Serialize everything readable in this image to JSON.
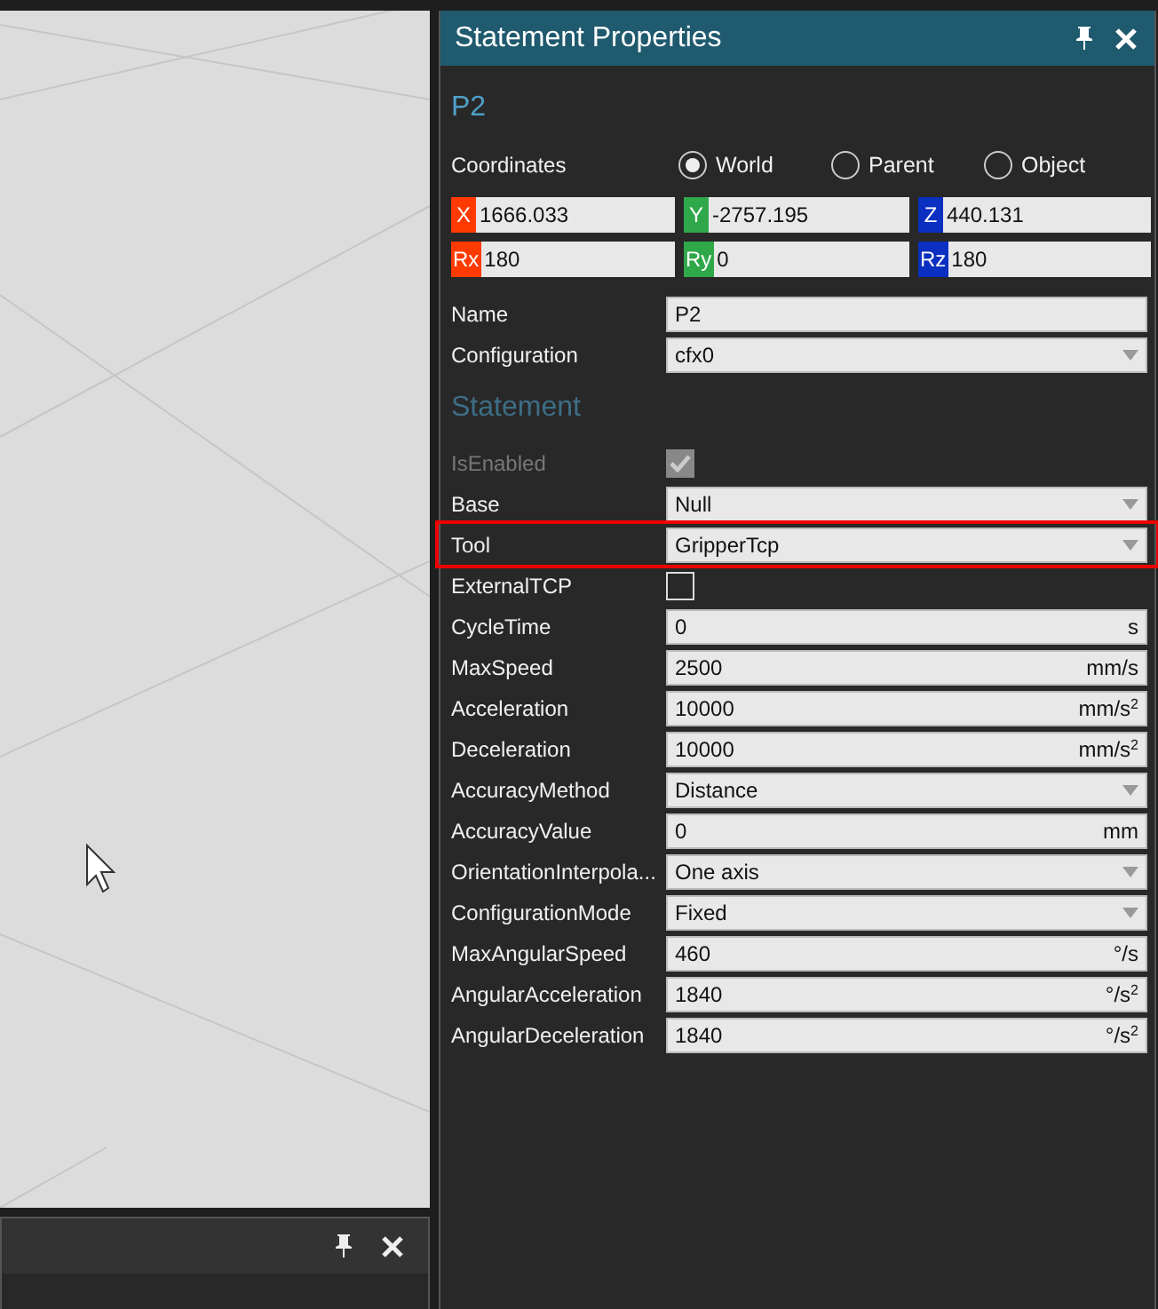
{
  "properties_panel": {
    "title": "Statement Properties",
    "object_name": "P2",
    "coordinates": {
      "label": "Coordinates",
      "options": [
        {
          "label": "World",
          "selected": true
        },
        {
          "label": "Parent",
          "selected": false
        },
        {
          "label": "Object",
          "selected": false
        }
      ]
    },
    "axes": [
      {
        "label": "X",
        "color": "#ff3a00",
        "value": "1666.033"
      },
      {
        "label": "Y",
        "color": "#2fa84a",
        "value": "-2757.195"
      },
      {
        "label": "Z",
        "color": "#0b2fc0",
        "value": "440.131"
      },
      {
        "label": "Rx",
        "color": "#ff3a00",
        "value": "180"
      },
      {
        "label": "Ry",
        "color": "#2fa84a",
        "value": "0"
      },
      {
        "label": "Rz",
        "color": "#0b2fc0",
        "value": "180"
      }
    ],
    "general": [
      {
        "kind": "text",
        "label": "Name",
        "value": "P2"
      },
      {
        "kind": "dropdown",
        "label": "Configuration",
        "value": "cfx0"
      }
    ],
    "section_title": "Statement",
    "statement": [
      {
        "kind": "checkbox",
        "label": "IsEnabled",
        "checked": true,
        "disabled": true
      },
      {
        "kind": "dropdown",
        "label": "Base",
        "value": "Null"
      },
      {
        "kind": "dropdown",
        "label": "Tool",
        "value": "GripperTcp",
        "highlighted": true
      },
      {
        "kind": "checkbox",
        "label": "ExternalTCP",
        "checked": false,
        "disabled": false
      },
      {
        "kind": "text",
        "label": "CycleTime",
        "value": "0",
        "unit": "s"
      },
      {
        "kind": "text",
        "label": "MaxSpeed",
        "value": "2500",
        "unit": "mm/s"
      },
      {
        "kind": "text",
        "label": "Acceleration",
        "value": "10000",
        "unit": "mm/s$^{2}$"
      },
      {
        "kind": "text",
        "label": "Deceleration",
        "value": "10000",
        "unit": "mm/s$^{2}$"
      },
      {
        "kind": "dropdown",
        "label": "AccuracyMethod",
        "value": "Distance"
      },
      {
        "kind": "text",
        "label": "AccuracyValue",
        "value": "0",
        "unit": "mm"
      },
      {
        "kind": "dropdown",
        "label": "OrientationInterpola...",
        "value": "One axis"
      },
      {
        "kind": "dropdown",
        "label": "ConfigurationMode",
        "value": "Fixed"
      },
      {
        "kind": "text",
        "label": "MaxAngularSpeed",
        "value": "460",
        "unit": "°/s"
      },
      {
        "kind": "text",
        "label": "AngularAcceleration",
        "value": "1840",
        "unit": "°/s$^{2}$"
      },
      {
        "kind": "text",
        "label": "AngularDeceleration",
        "value": "1840",
        "unit": "°/s$^{2}$"
      }
    ]
  }
}
